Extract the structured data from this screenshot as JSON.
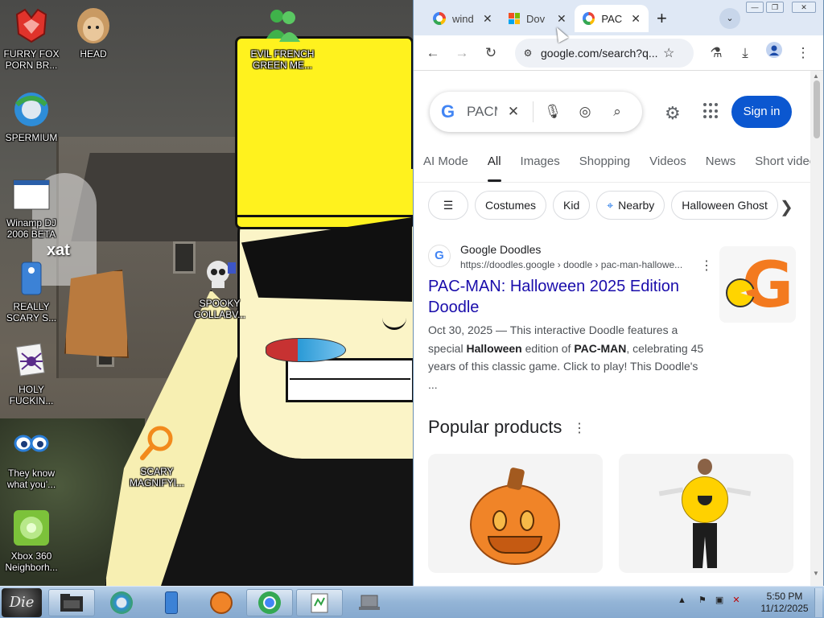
{
  "desktop": {
    "icons": [
      {
        "label": "FURRY FOX\nPORN BR...",
        "icon": "fox-browser-icon"
      },
      {
        "label": "HEAD",
        "icon": "head-icon"
      },
      {
        "label": "EVIL FRENCH\nGREEN ME...",
        "icon": "messenger-icon"
      },
      {
        "label": "SPERMIUM",
        "icon": "globe-browser-icon"
      },
      {
        "label": "Winamp DJ\n2006 BETA",
        "icon": "winamp-icon"
      },
      {
        "label": "REALLY\nSCARY S...",
        "icon": "xat-icon"
      },
      {
        "label": "SPOOKY\nCOLLABV...",
        "icon": "skull-icon"
      },
      {
        "label": "HOLY\nFUCKIN...",
        "icon": "spider-icon"
      },
      {
        "label": "They know\nwhat you'...",
        "icon": "eyes-icon"
      },
      {
        "label": "SCARY\nMAGNIFYI...",
        "icon": "magnifier-icon"
      },
      {
        "label": "Xbox 360\nNeighborh...",
        "icon": "xbox-icon"
      }
    ],
    "xat_text": "xat"
  },
  "browser": {
    "tabs": [
      {
        "label": "wind",
        "favicon": "google-icon",
        "active": false
      },
      {
        "label": "Dov",
        "favicon": "microsoft-icon",
        "active": false
      },
      {
        "label": "PAC",
        "favicon": "google-icon",
        "active": true
      }
    ],
    "new_tab": "+",
    "tab_search": "⌄",
    "address": "google.com/search?q...",
    "search": {
      "value": "PACM",
      "filters": [
        "AI Mode",
        "All",
        "Images",
        "Shopping",
        "Videos",
        "News",
        "Short video"
      ],
      "active_filter": "All",
      "chips": [
        "Costumes",
        "Kid",
        "Nearby",
        "Halloween Ghost"
      ],
      "sign_in": "Sign in"
    },
    "result": {
      "site_name": "Google Doodles",
      "site_url": "https://doodles.google › doodle › pac-man-hallowe...",
      "title": "PAC-MAN: Halloween 2025 Edition Doodle",
      "snippet_date": "Oct 30, 2025",
      "snippet_1": " — This interactive Doodle features a special ",
      "snippet_bold_1": "Halloween",
      "snippet_2": " edition of ",
      "snippet_bold_2": "PAC-MAN",
      "snippet_3": ", celebrating 45 years of this classic game. Click to play! This Doodle's ..."
    },
    "popular_products": {
      "title": "Popular products"
    }
  },
  "taskbar": {
    "start_label": "Die",
    "clock_time": "5:50 PM",
    "clock_date": "11/12/2025",
    "tray_arrow": "▲"
  },
  "colors": {
    "google_blue": "#0b57d0",
    "link": "#1a0dab",
    "hat_yellow": "#fff21e"
  }
}
